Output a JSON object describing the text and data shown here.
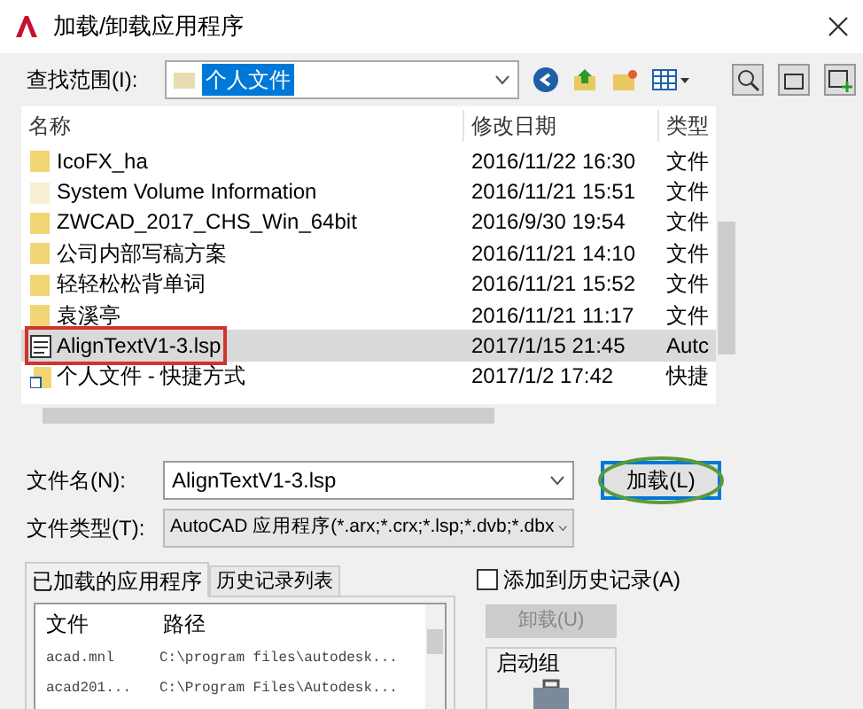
{
  "window": {
    "title": "加载/卸载应用程序"
  },
  "look_in": {
    "label": "查找范围(I):",
    "value": "个人文件"
  },
  "file_list": {
    "columns": [
      "名称",
      "修改日期",
      "类型"
    ],
    "rows": [
      {
        "kind": "folder",
        "name": "IcoFX_ha",
        "date": "2016/11/22 16:30",
        "type": "文件",
        "selected": false
      },
      {
        "kind": "hidden_folder",
        "name": "System Volume Information",
        "date": "2016/11/21 15:51",
        "type": "文件",
        "selected": false
      },
      {
        "kind": "folder",
        "name": "ZWCAD_2017_CHS_Win_64bit",
        "date": "2016/9/30 19:54",
        "type": "文件",
        "selected": false
      },
      {
        "kind": "folder",
        "name": "公司内部写稿方案",
        "date": "2016/11/21 14:10",
        "type": "文件",
        "selected": false
      },
      {
        "kind": "folder",
        "name": "轻轻松松背单词",
        "date": "2016/11/21 15:52",
        "type": "文件",
        "selected": false
      },
      {
        "kind": "folder",
        "name": "袁溪亭",
        "date": "2016/11/21 11:17",
        "type": "文件",
        "selected": false
      },
      {
        "kind": "lsp",
        "name": "AlignTextV1-3.lsp",
        "date": "2017/1/15 21:45",
        "type": "Autc",
        "selected": true
      },
      {
        "kind": "shortcut",
        "name": "个人文件 - 快捷方式",
        "date": "2017/1/2 17:42",
        "type": "快捷",
        "selected": false
      }
    ]
  },
  "file_name": {
    "label": "文件名(N):",
    "value": "AlignTextV1-3.lsp"
  },
  "load_button": {
    "label": "加载(L)"
  },
  "file_type": {
    "label": "文件类型(T):",
    "value": "AutoCAD 应用程序(*.arx;*.crx;*.lsp;*.dvb;*.dbx"
  },
  "tabs": [
    {
      "label": "已加载的应用程序",
      "selected": true
    },
    {
      "label": "历史记录列表",
      "selected": false
    }
  ],
  "add_to_history": {
    "label": "添加到历史记录(A)",
    "checked": false
  },
  "loaded_apps": {
    "columns": [
      "文件",
      "路径"
    ],
    "rows": [
      {
        "file": "acad.mnl",
        "path": "C:\\program files\\autodesk..."
      },
      {
        "file": "acad201...",
        "path": "C:\\Program Files\\Autodesk..."
      }
    ]
  },
  "unload_button": {
    "label": "卸载(U)",
    "disabled": true
  },
  "startup_group": {
    "title": "启动组"
  }
}
